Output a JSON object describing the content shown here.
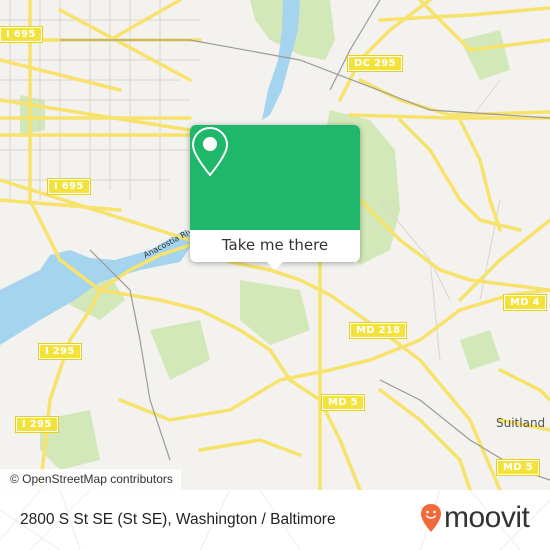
{
  "map": {
    "colors": {
      "background": "#f3f2ee",
      "water": "#a5d4ee",
      "park": "#d3e8b8",
      "major_road": "#f7e36b",
      "minor_road": "#d9d5cc",
      "rail": "#9a9a9a"
    },
    "road_shields": [
      {
        "label": "I 695"
      },
      {
        "label": "I 695"
      },
      {
        "label": "DC 295"
      },
      {
        "label": "I 295"
      },
      {
        "label": "I 295"
      },
      {
        "label": "MD 218"
      },
      {
        "label": "MD 4"
      },
      {
        "label": "MD 5"
      },
      {
        "label": "MD 5"
      }
    ],
    "place_labels": {
      "suitland": "Suitland",
      "river": "Anacostia River"
    },
    "attribution": "© OpenStreetMap contributors"
  },
  "popup": {
    "icon": "map-pin-icon",
    "button_label": "Take me there",
    "color": "#1fb86a"
  },
  "footer": {
    "address": "2800 S St SE (St SE), Washington / Baltimore",
    "logo_text": "moovit",
    "logo_color": "#f26a3c"
  }
}
